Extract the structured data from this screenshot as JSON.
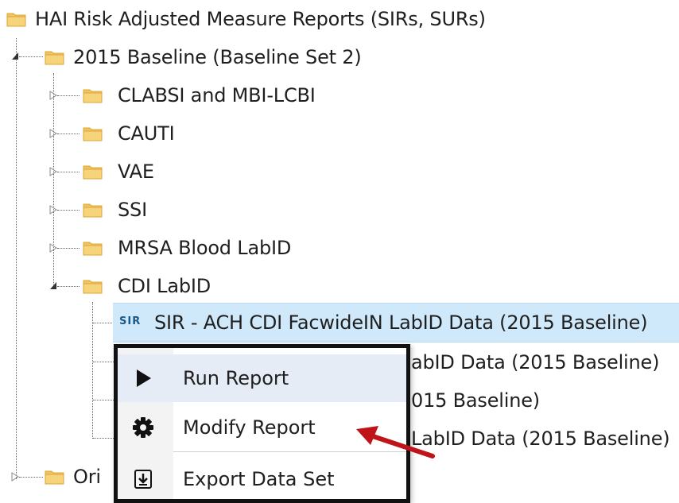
{
  "tree": {
    "root": {
      "label": "HAI Risk Adjusted Measure Reports (SIRs, SURs)"
    },
    "baseline": {
      "label": "2015 Baseline (Baseline Set 2)"
    },
    "folders": [
      {
        "label": "CLABSI and MBI-LCBI"
      },
      {
        "label": "CAUTI"
      },
      {
        "label": "VAE"
      },
      {
        "label": "SSI"
      },
      {
        "label": "MRSA Blood LabID"
      },
      {
        "label": "CDI LabID"
      }
    ],
    "reports": [
      {
        "badge": "SIR",
        "label": "SIR - ACH CDI FacwideIN LabID Data (2015 Baseline)"
      },
      {
        "label": "abID Data (2015 Baseline)"
      },
      {
        "label": "015 Baseline)"
      },
      {
        "label": "LabID Data (2015 Baseline)"
      }
    ],
    "bottom": {
      "label": "Ori"
    }
  },
  "context_menu": {
    "items": [
      {
        "label": "Run Report",
        "icon": "play-icon"
      },
      {
        "label": "Modify Report",
        "icon": "gear-icon"
      },
      {
        "label": "Export Data Set",
        "icon": "export-icon"
      }
    ]
  },
  "colors": {
    "selection": "#cfe9fb",
    "folder": "#f2c55c",
    "arrow": "#c0141b"
  }
}
